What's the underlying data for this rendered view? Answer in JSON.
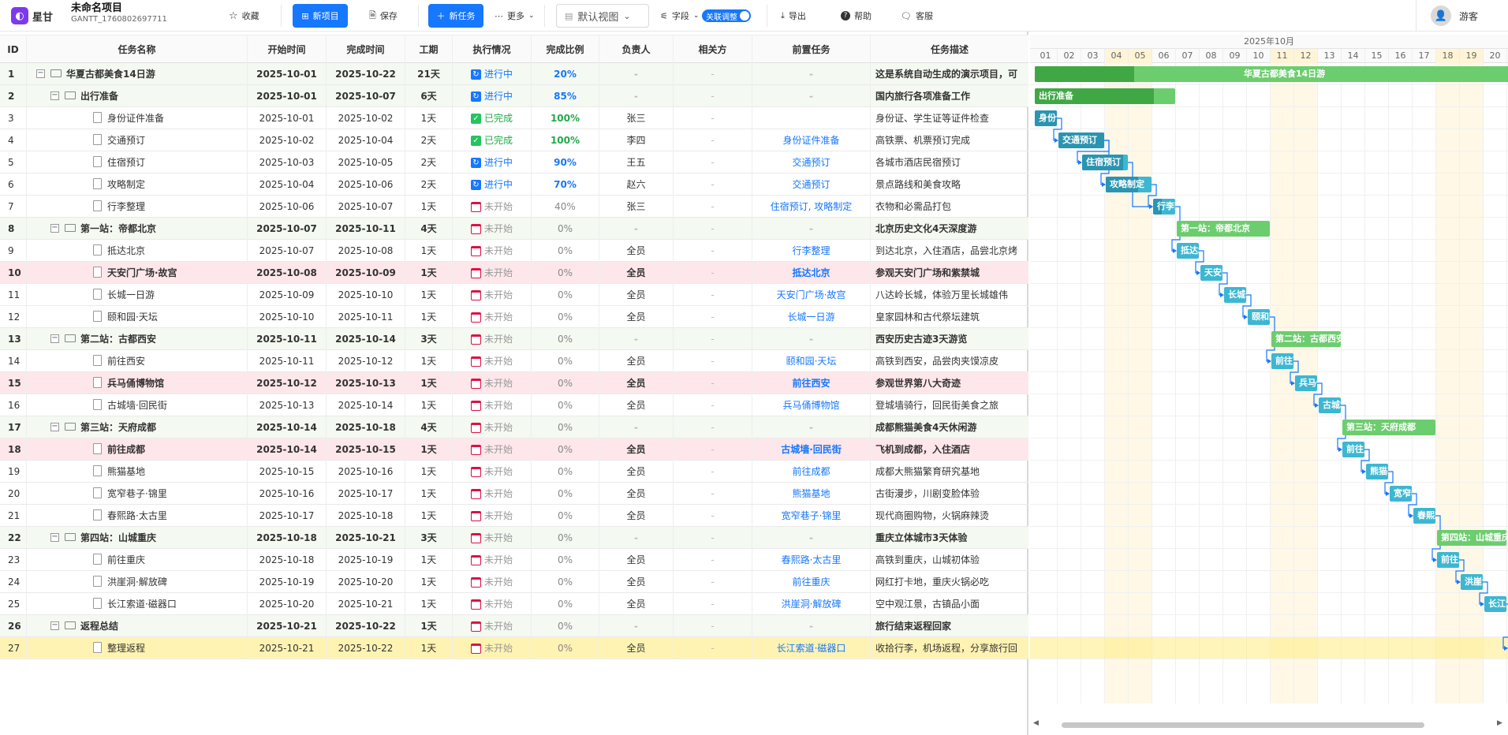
{
  "app": {
    "brand": "星甘",
    "project_title": "未命名项目",
    "project_code": "GANTT_1760802697711"
  },
  "toolbar": {
    "favorite": "收藏",
    "new_project": "新项目",
    "save": "保存",
    "new_task": "新任务",
    "more": "更多",
    "view": "默认视图",
    "fields": "字段",
    "link_adjust": "关联调整",
    "export": "导出",
    "help": "帮助",
    "support": "客服",
    "user": "游客"
  },
  "columns": [
    "ID",
    "任务名称",
    "开始时间",
    "完成时间",
    "工期",
    "执行情况",
    "完成比例",
    "负责人",
    "相关方",
    "前置任务",
    "任务描述"
  ],
  "status_labels": {
    "prog": "进行中",
    "done": "已完成",
    "todo": "未开始"
  },
  "tasks": [
    {
      "id": "1",
      "name": "华夏古都美食14日游",
      "level": 0,
      "summary": true,
      "start": "2025-10-01",
      "end": "2025-10-22",
      "dur": "21天",
      "status": "prog",
      "pct": "20%",
      "owner": "-",
      "rel": "-",
      "pred": "-",
      "desc": "这是系统自动生成的演示项目，可"
    },
    {
      "id": "2",
      "name": "出行准备",
      "level": 1,
      "summary": true,
      "start": "2025-10-01",
      "end": "2025-10-07",
      "dur": "6天",
      "status": "prog",
      "pct": "85%",
      "owner": "-",
      "rel": "-",
      "pred": "-",
      "desc": "国内旅行各项准备工作"
    },
    {
      "id": "3",
      "name": "身份证件准备",
      "level": 2,
      "summary": false,
      "start": "2025-10-01",
      "end": "2025-10-02",
      "dur": "1天",
      "status": "done",
      "pct": "100%",
      "owner": "张三",
      "rel": "-",
      "pred": "",
      "desc": "身份证、学生证等证件检查"
    },
    {
      "id": "4",
      "name": "交通预订",
      "level": 2,
      "summary": false,
      "start": "2025-10-02",
      "end": "2025-10-04",
      "dur": "2天",
      "status": "done",
      "pct": "100%",
      "owner": "李四",
      "rel": "-",
      "pred": "身份证件准备",
      "desc": "高铁票、机票预订完成"
    },
    {
      "id": "5",
      "name": "住宿预订",
      "level": 2,
      "summary": false,
      "start": "2025-10-03",
      "end": "2025-10-05",
      "dur": "2天",
      "status": "prog",
      "pct": "90%",
      "owner": "王五",
      "rel": "-",
      "pred": "交通预订",
      "desc": "各城市酒店民宿预订"
    },
    {
      "id": "6",
      "name": "攻略制定",
      "level": 2,
      "summary": false,
      "start": "2025-10-04",
      "end": "2025-10-06",
      "dur": "2天",
      "status": "prog",
      "pct": "70%",
      "owner": "赵六",
      "rel": "-",
      "pred": "交通预订",
      "desc": "景点路线和美食攻略"
    },
    {
      "id": "7",
      "name": "行李整理",
      "level": 2,
      "summary": false,
      "start": "2025-10-06",
      "end": "2025-10-07",
      "dur": "1天",
      "status": "todo",
      "pct": "40%",
      "owner": "张三",
      "rel": "-",
      "pred": "住宿预订, 攻略制定",
      "desc": "衣物和必需品打包"
    },
    {
      "id": "8",
      "name": "第一站：帝都北京",
      "level": 1,
      "summary": true,
      "start": "2025-10-07",
      "end": "2025-10-11",
      "dur": "4天",
      "status": "todo",
      "pct": "0%",
      "owner": "-",
      "rel": "-",
      "pred": "-",
      "desc": "北京历史文化4天深度游"
    },
    {
      "id": "9",
      "name": "抵达北京",
      "level": 2,
      "summary": false,
      "start": "2025-10-07",
      "end": "2025-10-08",
      "dur": "1天",
      "status": "todo",
      "pct": "0%",
      "owner": "全员",
      "rel": "-",
      "pred": "行李整理",
      "desc": "到达北京，入住酒店，品尝北京烤"
    },
    {
      "id": "10",
      "name": "天安门广场·故宫",
      "level": 2,
      "summary": false,
      "crit": true,
      "start": "2025-10-08",
      "end": "2025-10-09",
      "dur": "1天",
      "status": "todo",
      "pct": "0%",
      "owner": "全员",
      "rel": "-",
      "pred": "抵达北京",
      "desc": "参观天安门广场和紫禁城"
    },
    {
      "id": "11",
      "name": "长城一日游",
      "level": 2,
      "summary": false,
      "start": "2025-10-09",
      "end": "2025-10-10",
      "dur": "1天",
      "status": "todo",
      "pct": "0%",
      "owner": "全员",
      "rel": "-",
      "pred": "天安门广场·故宫",
      "desc": "八达岭长城，体验万里长城雄伟"
    },
    {
      "id": "12",
      "name": "颐和园·天坛",
      "level": 2,
      "summary": false,
      "start": "2025-10-10",
      "end": "2025-10-11",
      "dur": "1天",
      "status": "todo",
      "pct": "0%",
      "owner": "全员",
      "rel": "-",
      "pred": "长城一日游",
      "desc": "皇家园林和古代祭坛建筑"
    },
    {
      "id": "13",
      "name": "第二站：古都西安",
      "level": 1,
      "summary": true,
      "start": "2025-10-11",
      "end": "2025-10-14",
      "dur": "3天",
      "status": "todo",
      "pct": "0%",
      "owner": "-",
      "rel": "-",
      "pred": "-",
      "desc": "西安历史古迹3天游览"
    },
    {
      "id": "14",
      "name": "前往西安",
      "level": 2,
      "summary": false,
      "start": "2025-10-11",
      "end": "2025-10-12",
      "dur": "1天",
      "status": "todo",
      "pct": "0%",
      "owner": "全员",
      "rel": "-",
      "pred": "颐和园·天坛",
      "desc": "高铁到西安，品尝肉夹馍凉皮"
    },
    {
      "id": "15",
      "name": "兵马俑博物馆",
      "level": 2,
      "summary": false,
      "crit": true,
      "start": "2025-10-12",
      "end": "2025-10-13",
      "dur": "1天",
      "status": "todo",
      "pct": "0%",
      "owner": "全员",
      "rel": "-",
      "pred": "前往西安",
      "desc": "参观世界第八大奇迹"
    },
    {
      "id": "16",
      "name": "古城墙·回民街",
      "level": 2,
      "summary": false,
      "start": "2025-10-13",
      "end": "2025-10-14",
      "dur": "1天",
      "status": "todo",
      "pct": "0%",
      "owner": "全员",
      "rel": "-",
      "pred": "兵马俑博物馆",
      "desc": "登城墙骑行，回民街美食之旅"
    },
    {
      "id": "17",
      "name": "第三站：天府成都",
      "level": 1,
      "summary": true,
      "start": "2025-10-14",
      "end": "2025-10-18",
      "dur": "4天",
      "status": "todo",
      "pct": "0%",
      "owner": "-",
      "rel": "-",
      "pred": "-",
      "desc": "成都熊猫美食4天休闲游"
    },
    {
      "id": "18",
      "name": "前往成都",
      "level": 2,
      "summary": false,
      "crit": true,
      "start": "2025-10-14",
      "end": "2025-10-15",
      "dur": "1天",
      "status": "todo",
      "pct": "0%",
      "owner": "全员",
      "rel": "-",
      "pred": "古城墙·回民街",
      "desc": "飞机到成都，入住酒店"
    },
    {
      "id": "19",
      "name": "熊猫基地",
      "level": 2,
      "summary": false,
      "start": "2025-10-15",
      "end": "2025-10-16",
      "dur": "1天",
      "status": "todo",
      "pct": "0%",
      "owner": "全员",
      "rel": "-",
      "pred": "前往成都",
      "desc": "成都大熊猫繁育研究基地"
    },
    {
      "id": "20",
      "name": "宽窄巷子·锦里",
      "level": 2,
      "summary": false,
      "start": "2025-10-16",
      "end": "2025-10-17",
      "dur": "1天",
      "status": "todo",
      "pct": "0%",
      "owner": "全员",
      "rel": "-",
      "pred": "熊猫基地",
      "desc": "古街漫步，川剧变脸体验"
    },
    {
      "id": "21",
      "name": "春熙路·太古里",
      "level": 2,
      "summary": false,
      "start": "2025-10-17",
      "end": "2025-10-18",
      "dur": "1天",
      "status": "todo",
      "pct": "0%",
      "owner": "全员",
      "rel": "-",
      "pred": "宽窄巷子·锦里",
      "desc": "现代商圈购物，火锅麻辣烫"
    },
    {
      "id": "22",
      "name": "第四站：山城重庆",
      "level": 1,
      "summary": true,
      "start": "2025-10-18",
      "end": "2025-10-21",
      "dur": "3天",
      "status": "todo",
      "pct": "0%",
      "owner": "-",
      "rel": "-",
      "pred": "-",
      "desc": "重庆立体城市3天体验"
    },
    {
      "id": "23",
      "name": "前往重庆",
      "level": 2,
      "summary": false,
      "start": "2025-10-18",
      "end": "2025-10-19",
      "dur": "1天",
      "status": "todo",
      "pct": "0%",
      "owner": "全员",
      "rel": "-",
      "pred": "春熙路·太古里",
      "desc": "高铁到重庆，山城初体验"
    },
    {
      "id": "24",
      "name": "洪崖洞·解放碑",
      "level": 2,
      "summary": false,
      "start": "2025-10-19",
      "end": "2025-10-20",
      "dur": "1天",
      "status": "todo",
      "pct": "0%",
      "owner": "全员",
      "rel": "-",
      "pred": "前往重庆",
      "desc": "网红打卡地，重庆火锅必吃"
    },
    {
      "id": "25",
      "name": "长江索道·磁器口",
      "level": 2,
      "summary": false,
      "start": "2025-10-20",
      "end": "2025-10-21",
      "dur": "1天",
      "status": "todo",
      "pct": "0%",
      "owner": "全员",
      "rel": "-",
      "pred": "洪崖洞·解放碑",
      "desc": "空中观江景，古镇品小面"
    },
    {
      "id": "26",
      "name": "返程总结",
      "level": 1,
      "summary": true,
      "start": "2025-10-21",
      "end": "2025-10-22",
      "dur": "1天",
      "status": "todo",
      "pct": "0%",
      "owner": "-",
      "rel": "-",
      "pred": "-",
      "desc": "旅行结束返程回家"
    },
    {
      "id": "27",
      "name": "整理返程",
      "level": 2,
      "summary": false,
      "hl": true,
      "start": "2025-10-21",
      "end": "2025-10-22",
      "dur": "1天",
      "status": "todo",
      "pct": "0%",
      "owner": "全员",
      "rel": "-",
      "pred": "长江索道·磁器口",
      "desc": "收拾行李，机场返程，分享旅行回"
    }
  ],
  "gantt": {
    "month_label": "2025年10月",
    "days": [
      "01",
      "02",
      "03",
      "04",
      "05",
      "06",
      "07",
      "08",
      "09",
      "10",
      "11",
      "12",
      "13",
      "14",
      "15",
      "16",
      "17",
      "18",
      "19",
      "20"
    ],
    "weekend_days": [
      "04",
      "05",
      "11",
      "12",
      "18",
      "19"
    ],
    "bar_labels": [
      "华夏古都美食14日游",
      "出行准备",
      "身份证件准备",
      "交通预订",
      "住宿预订",
      "攻略制定",
      "行李整理",
      "第一站：帝都北京",
      "抵达北京",
      "天安门广场·故宫",
      "长城一日游",
      "颐和园·天坛",
      "第二站：古都西安",
      "前往西安",
      "兵马俑博物馆",
      "古城墙·回民街",
      "第三站：天府成都",
      "前往成都",
      "熊猫基地",
      "宽窄巷子·锦里",
      "春熙路·太古里",
      "第四站：山城重庆",
      "前往重庆",
      "洪崖洞·解放碑",
      "长江索道·磁器口",
      "返程总结",
      "整理返程"
    ],
    "colors": {
      "summary": "#6ccd6e",
      "summary_done": "#3fa845",
      "task": "#3db7d1",
      "task_done": "#2a95b0",
      "link": "#1677ff"
    }
  }
}
